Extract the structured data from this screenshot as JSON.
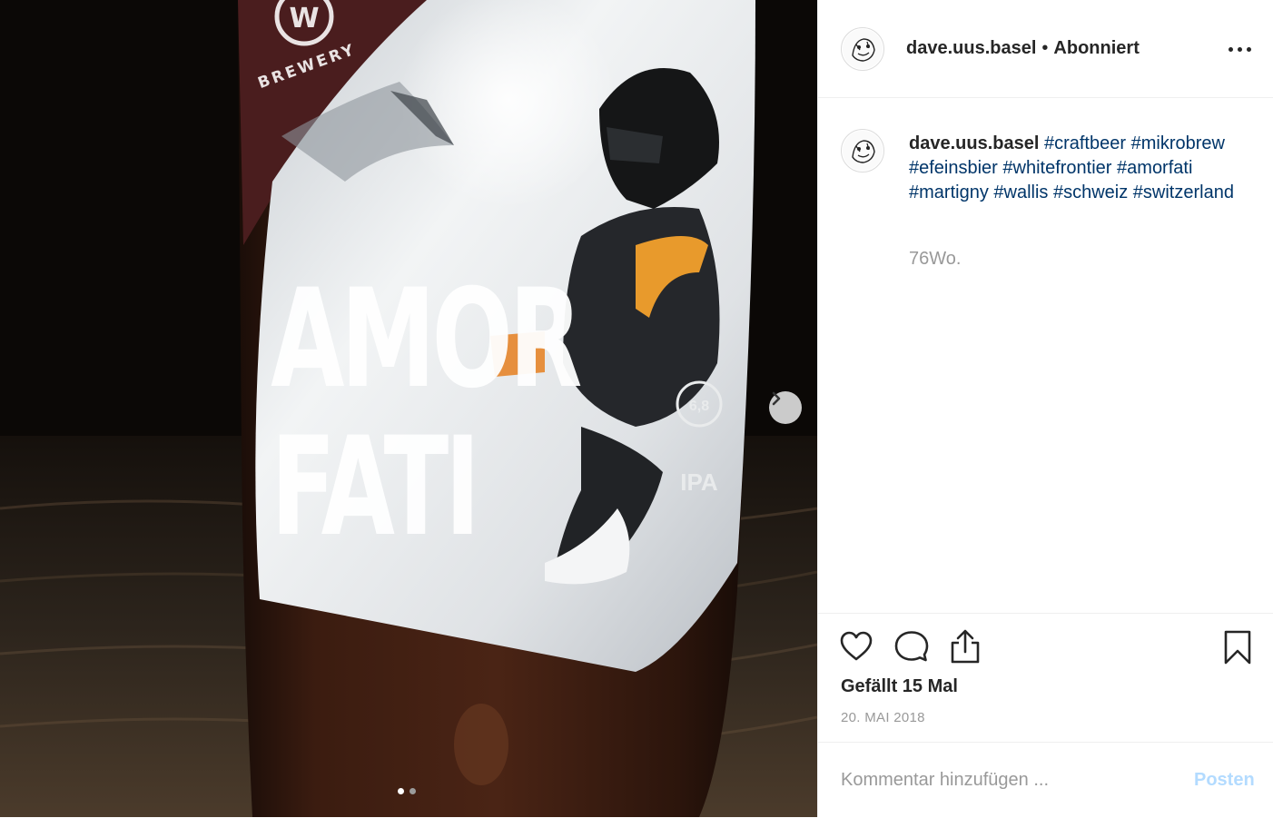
{
  "post": {
    "username": "dave.uus.basel",
    "separator": "•",
    "follow_status": "Abonniert",
    "caption": {
      "username": "dave.uus.basel",
      "hashtags": [
        "#craftbeer",
        "#mikrobrew",
        "#efeinsbier",
        "#whitefrontier",
        "#amorfati",
        "#martigny",
        "#wallis",
        "#schweiz",
        "#switzerland"
      ],
      "time_ago": "76Wo."
    },
    "likes_text": "Gefällt 15 Mal",
    "date": "20. MAI 2018",
    "comment_placeholder": "Kommentar hinzufügen ...",
    "post_button": "Posten"
  },
  "photo": {
    "label_text_line1": "AMOR",
    "label_text_line2": "FATI",
    "brewery_text": "BREWERY",
    "abv_text": "6,8",
    "style_text": "IPA",
    "carousel_total": 2,
    "carousel_active": 1
  },
  "icons": {
    "more": "more-options-icon",
    "like": "heart-icon",
    "comment": "comment-icon",
    "share": "share-icon",
    "save": "bookmark-icon",
    "next": "chevron-right-icon"
  }
}
